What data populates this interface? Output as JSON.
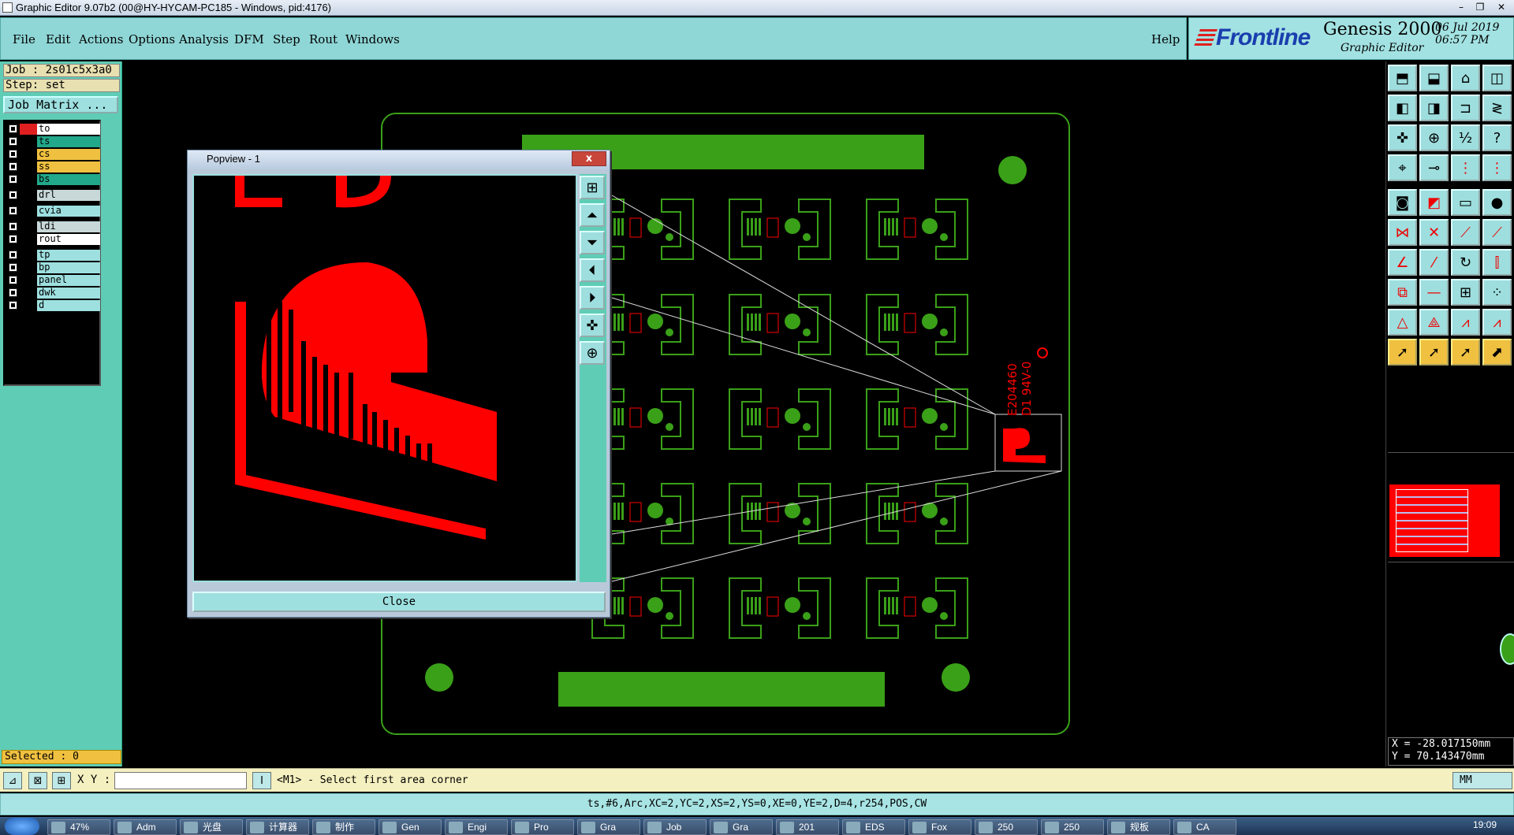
{
  "window": {
    "title": "Graphic Editor 9.07b2 (00@HY-HYCAM-PC185 - Windows, pid:4176)",
    "minimize": "–",
    "restore": "❐",
    "close": "✕"
  },
  "menu": [
    {
      "label": "File"
    },
    {
      "label": "Edit"
    },
    {
      "label": "Actions"
    },
    {
      "label": "Options"
    },
    {
      "label": "Analysis"
    },
    {
      "label": "DFM"
    },
    {
      "label": "Step"
    },
    {
      "label": "Rout"
    },
    {
      "label": "Windows"
    }
  ],
  "help": "Help",
  "logo": {
    "brand": "Frontline",
    "product": "Genesis 2000",
    "subtitle": "Graphic Editor",
    "date": "06 Jul 2019",
    "time": "06:57 PM"
  },
  "job": {
    "job_line": "Job : 2s01c5x3a0",
    "step_line": "Step: set",
    "matrix_button": "Job Matrix ..."
  },
  "layers": [
    {
      "name": "to",
      "color": "#ffffff",
      "swatch": "#e02020"
    },
    {
      "name": "ts",
      "color": "#22a88a",
      "swatch": "#000000"
    },
    {
      "name": "cs",
      "color": "#f0c040",
      "swatch": "#000000"
    },
    {
      "name": "ss",
      "color": "#f0c040",
      "swatch": "#000000"
    },
    {
      "name": "bs",
      "color": "#22a88a",
      "swatch": "#000000"
    },
    {
      "name": "drl",
      "color": "#c8d8d8",
      "swatch": "#000000"
    },
    {
      "name": "cvia",
      "color": "#9ee0e0",
      "swatch": "#000000"
    },
    {
      "name": "ldi",
      "color": "#c8d8d8",
      "swatch": "#000000"
    },
    {
      "name": "rout",
      "color": "#ffffff",
      "swatch": "#000000"
    },
    {
      "name": "tp",
      "color": "#9ee0e0",
      "swatch": "#000000"
    },
    {
      "name": "bp",
      "color": "#9ee0e0",
      "swatch": "#000000"
    },
    {
      "name": "panel",
      "color": "#9ee0e0",
      "swatch": "#000000"
    },
    {
      "name": "dwk",
      "color": "#9ee0e0",
      "swatch": "#000000"
    },
    {
      "name": "d",
      "color": "#9ee0e0",
      "swatch": "#000000"
    }
  ],
  "selected": "Selected : 0",
  "popview": {
    "title": "Popview - 1",
    "close_x": "x",
    "close_label": "Close"
  },
  "board": {
    "marking_line1": "E204460",
    "marking_line2": "D1 94V-0"
  },
  "coords": {
    "x": "X = -28.017150mm",
    "y": "Y =  70.143470mm"
  },
  "command": {
    "xy_label": "X Y :",
    "xy_value": "",
    "message": "<M1> - Select first area corner",
    "units": "MM"
  },
  "info": "ts,#6,Arc,XC=2,YC=2,XS=2,YS=0,XE=0,YE=2,D=4,r254,POS,CW",
  "taskbar": {
    "clock": "19:09",
    "tasks": [
      "47%",
      "Adm",
      "光盘",
      "计算器",
      "制作",
      "Gen",
      "Engi",
      "Pro",
      "Gra",
      "Job",
      "Gra",
      "201",
      "EDS",
      "Fox",
      "250",
      "250",
      "规板",
      "CA"
    ]
  },
  "colors": {
    "board_green": "#3aa018",
    "outline_green": "#3aa018",
    "red": "#ff0000",
    "panel_teal": "#5fcdb6"
  }
}
